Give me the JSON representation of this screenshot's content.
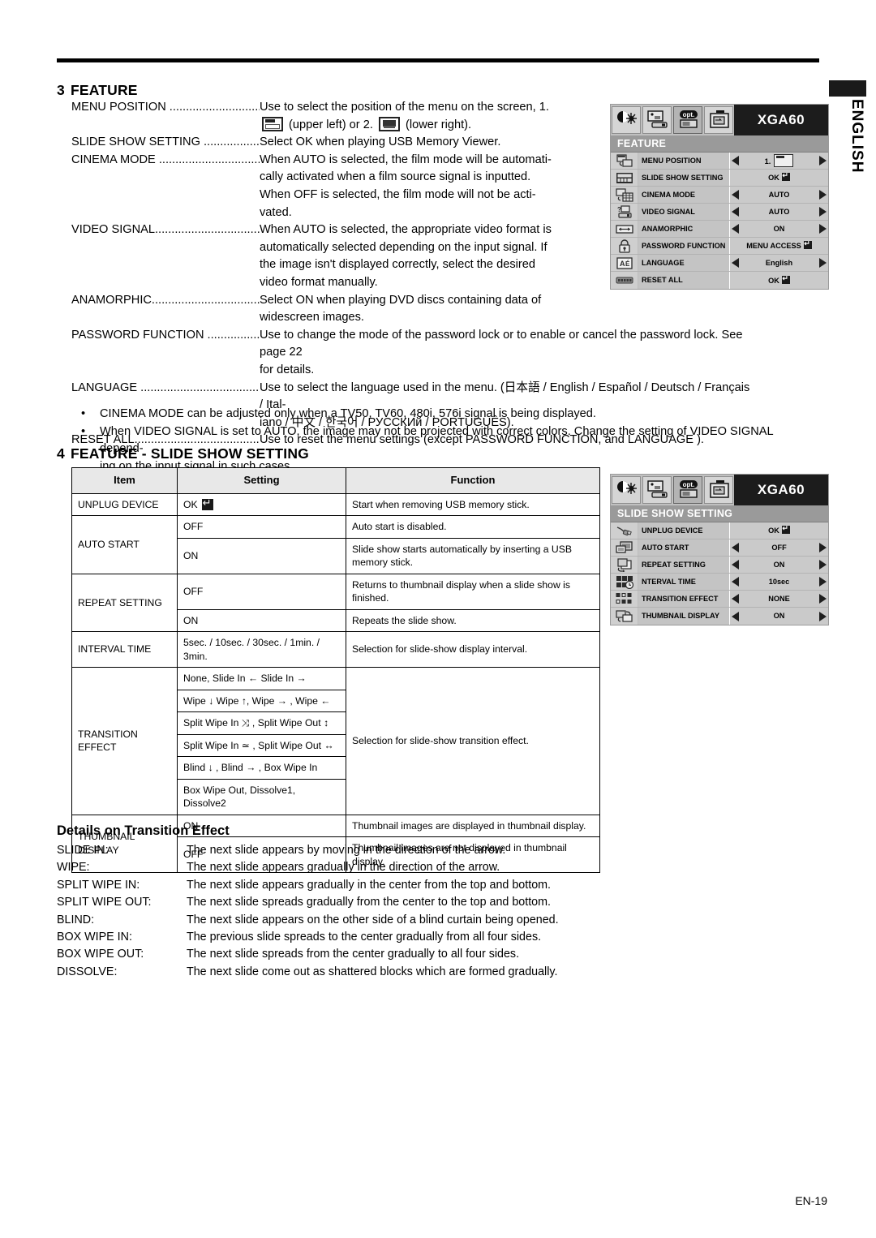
{
  "page": {
    "language_tab": "ENGLISH",
    "page_number": "EN-19"
  },
  "section3": {
    "number": "3",
    "title": "FEATURE",
    "items": [
      {
        "term": "MENU POSITION",
        "dots": " ......................................",
        "lines": [
          "Use to select the position of the menu on the screen, 1.",
          "(upper left) or 2.  (lower right)."
        ]
      },
      {
        "term": "SLIDE SHOW SETTING",
        "dots": " ............................",
        "lines": [
          "Select OK when playing USB Memory Viewer."
        ]
      },
      {
        "term": "CINEMA MODE",
        "dots": " .........................................",
        "lines": [
          "When AUTO is selected, the film mode will be automati-",
          "cally activated when a film source signal is inputted.",
          "When OFF is selected, the film mode will not be acti-",
          "vated."
        ]
      },
      {
        "term": "VIDEO SIGNAL",
        "dots": "..........................................",
        "lines": [
          "When AUTO is selected, the appropriate video format is",
          "automatically selected depending on the input signal. If",
          "the image isn't displayed correctly, select the desired",
          "video format manually."
        ]
      },
      {
        "term": "ANAMORPHIC",
        "dots": "...........................................",
        "lines": [
          "Select ON when playing DVD discs containing data of",
          "widescreen images."
        ]
      },
      {
        "term": "PASSWORD FUNCTION",
        "dots": " .............................",
        "lines": [
          "Use to change the mode of the password lock or to enable or cancel the password lock. See page 22",
          "for details."
        ]
      },
      {
        "term": "LANGUAGE",
        "dots": " ..............................................",
        "lines": [
          "Use to select the language used in the menu. (日本語 / English / Español / Deutsch / Français / Ital-",
          "iano / 中文 / 한국어 / РУССКИй / PORTUGUÊS)."
        ]
      },
      {
        "term": "RESET ALL",
        "dots": "...............................................",
        "lines": [
          "Use to reset the menu settings (except PASSWORD FUNCTION, and LANGUAGE )."
        ]
      }
    ],
    "menu_position_labels": {
      "upper": "(upper left) or 2.",
      "lower": "(lower right).",
      "prefix": "1."
    },
    "bullets": [
      {
        "mark": "•",
        "text": "CINEMA MODE can be adjusted only when a TV50, TV60, 480i, 576i signal is being displayed."
      },
      {
        "mark": "•",
        "text": "When VIDEO SIGNAL is set to AUTO, the image may not be projected with correct colors. Change the setting of VIDEO SIGNAL depend-"
      },
      {
        "mark": "",
        "text": "ing on the input signal in such cases."
      }
    ]
  },
  "section4": {
    "number": "4",
    "title": "FEATURE - SLIDE SHOW SETTING",
    "table": {
      "headers": [
        "Item",
        "Setting",
        "Function"
      ],
      "rows": [
        {
          "item": "UNPLUG DEVICE",
          "item_rowspan": 1,
          "setting": "OK",
          "setting_badge": true,
          "function": "Start when removing USB memory stick.",
          "function_rowspan": 1
        },
        {
          "item": "AUTO START",
          "item_rowspan": 2,
          "setting": "OFF",
          "function": "Auto start is disabled."
        },
        {
          "setting": "ON",
          "function": "Slide show starts automatically by inserting a USB memory stick."
        },
        {
          "item": "REPEAT SETTING",
          "item_rowspan": 2,
          "setting": "OFF",
          "function": "Returns to thumbnail display when a slide show is finished."
        },
        {
          "setting": "ON",
          "function": "Repeats the slide show."
        },
        {
          "item": "INTERVAL TIME",
          "item_rowspan": 1,
          "setting": "5sec. / 10sec. / 30sec. / 1min. / 3min.",
          "function": "Selection for slide-show display interval."
        },
        {
          "item": "TRANSITION EFFECT",
          "item_rowspan": 6,
          "setting": "None, Slide In ← Slide In →",
          "function": "Selection for slide-show transition effect.",
          "function_rowspan": 6
        },
        {
          "setting": "Wipe ↓ Wipe ↑, Wipe → , Wipe ←"
        },
        {
          "setting": "Split Wipe In ⤨ , Split Wipe Out ↕"
        },
        {
          "setting": "Split Wipe In ≃ , Split Wipe Out  ↔"
        },
        {
          "setting": "Blind ↓ , Blind → , Box Wipe In"
        },
        {
          "setting": "Box Wipe Out, Dissolve1, Dissolve2"
        },
        {
          "item": "THUMBNAIL DISPLAY",
          "item_rowspan": 2,
          "setting": "ON",
          "function": "Thumbnail images are displayed in thumbnail display."
        },
        {
          "setting": "OFF",
          "function": "Thumbnail images are not displayed in thumbnail display."
        }
      ]
    }
  },
  "details": {
    "title": "Details on Transition Effect",
    "rows": [
      {
        "label": "SLIDE IN:",
        "text": "The next slide appears by moving in the direction of the arrow."
      },
      {
        "label": "WIPE:",
        "text": "The next slide appears gradually in the direction of the arrow."
      },
      {
        "label": "SPLIT WIPE IN:",
        "text": "The next slide appears gradually in the center from the top and bottom."
      },
      {
        "label": "SPLIT WIPE OUT:",
        "text": "The next slide spreads gradually from the center to the top and bottom."
      },
      {
        "label": "BLIND:",
        "text": "The next slide appears on the other side of a blind curtain being opened."
      },
      {
        "label": "BOX WIPE IN:",
        "text": "The previous slide spreads to the center gradually from all four sides."
      },
      {
        "label": "BOX WIPE OUT:",
        "text": "The next slide spreads from the center gradually to all four sides."
      },
      {
        "label": "DISSOLVE:",
        "text": "The next slide come out as shattered blocks which are formed gradually."
      }
    ]
  },
  "osd_feature": {
    "signal_label": "XGA60",
    "menu_title": "FEATURE",
    "tabs": [
      "image-icon",
      "screen-icon",
      "opt-icon",
      "install-icon"
    ],
    "selected_tab_index": 2,
    "rows": [
      {
        "icon": "menu-position-icon",
        "label": "MENU POSITION",
        "value": "1.",
        "arrows": true,
        "glyph": "menu-pos-box"
      },
      {
        "icon": "slide-show-icon",
        "label": "SLIDE SHOW SETTING",
        "value": "OK",
        "arrows": false,
        "badge": true
      },
      {
        "icon": "cinema-mode-icon",
        "label": "CINEMA MODE",
        "value": "AUTO",
        "arrows": true
      },
      {
        "icon": "video-signal-icon",
        "label": "VIDEO SIGNAL",
        "value": "AUTO",
        "arrows": true
      },
      {
        "icon": "anamorphic-icon",
        "label": "ANAMORPHIC",
        "value": "ON",
        "arrows": true
      },
      {
        "icon": "password-icon",
        "label": "PASSWORD FUNCTION",
        "value": "MENU ACCESS",
        "arrows": false,
        "badge": true
      },
      {
        "icon": "language-icon",
        "label": "LANGUAGE",
        "value": "English",
        "arrows": true
      },
      {
        "icon": "reset-all-icon",
        "label": "RESET ALL",
        "value": "OK",
        "arrows": false,
        "badge": true
      }
    ]
  },
  "osd_slideshow": {
    "signal_label": "XGA60",
    "menu_title": "SLIDE SHOW SETTING",
    "tabs": [
      "image-icon",
      "screen-icon",
      "opt-icon",
      "install-icon"
    ],
    "selected_tab_index": 2,
    "rows": [
      {
        "icon": "unplug-device-icon",
        "label": "UNPLUG DEVICE",
        "value": "OK",
        "arrows": false,
        "badge": true
      },
      {
        "icon": "auto-start-icon",
        "label": "AUTO START",
        "value": "OFF",
        "arrows": true
      },
      {
        "icon": "repeat-setting-icon",
        "label": "REPEAT SETTING",
        "value": "ON",
        "arrows": true
      },
      {
        "icon": "interval-time-icon",
        "label": "NTERVAL TIME",
        "value": "10sec",
        "arrows": true
      },
      {
        "icon": "transition-effect-icon",
        "label": "TRANSITION EFFECT",
        "value": "NONE",
        "arrows": true
      },
      {
        "icon": "thumbnail-display-icon",
        "label": "THUMBNAIL DISPLAY",
        "value": "ON",
        "arrows": true
      }
    ]
  }
}
